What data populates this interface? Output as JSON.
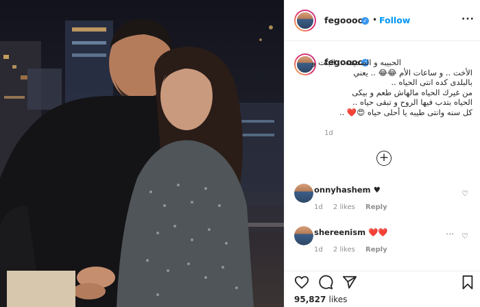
{
  "post": {
    "username": "fegoooo",
    "verified_mark": "✓",
    "header_dot": "•",
    "follow_label": "Follow",
    "more_label": "···",
    "caption": {
      "username": "fegoooo",
      "lines": [
        "الحبيبه و الصديقه .. البنت و",
        "الأخت .. و ساعات الأم 😂😂 .. يعني",
        "بالبلدى كده انتى الحياه ..",
        "من غيرك الحياه مالهاش طعم و بيكى",
        "الحياه بتدب فيها الروح و تبقى حياه ..",
        "كل سنه وانتى طيبه يا أحلى حياه 😍❤️ .."
      ],
      "time": "1d"
    },
    "load_more_icon": "plus-circle-icon",
    "comments": [
      {
        "username": "onnyhashem",
        "text": "♥",
        "time": "1d",
        "likes": "2 likes",
        "reply": "Reply"
      },
      {
        "username": "shereenism",
        "text": "❤️❤️",
        "time": "1d",
        "likes": "2 likes",
        "reply": "Reply",
        "more": "···"
      }
    ],
    "likes_count": "95,827",
    "likes_label": "likes"
  },
  "icons": [
    "heart-icon",
    "comment-icon",
    "share-icon",
    "bookmark-icon",
    "verified-icon"
  ],
  "colors": {
    "accent": "#0095f6",
    "verified": "#3897f0",
    "text": "#262626",
    "muted": "#8e8e8e",
    "border": "#efefef"
  }
}
